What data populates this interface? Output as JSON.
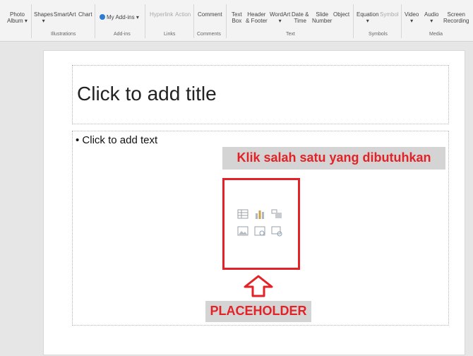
{
  "ribbon": {
    "items": [
      {
        "label": "Photo\nAlbum ▾"
      },
      {
        "label": "Shapes\n▾"
      },
      {
        "label": "SmartArt"
      },
      {
        "label": "Chart"
      },
      {
        "label": "My Add-ins"
      },
      {
        "label": "Hyperlink"
      },
      {
        "label": "Action"
      },
      {
        "label": "Comment"
      },
      {
        "label": "Text\nBox"
      },
      {
        "label": "Header\n& Footer"
      },
      {
        "label": "WordArt\n▾"
      },
      {
        "label": "Date &\nTime"
      },
      {
        "label": "Slide\nNumber"
      },
      {
        "label": "Object"
      },
      {
        "label": "Equation\n▾"
      },
      {
        "label": "Symbol"
      },
      {
        "label": "Video\n▾"
      },
      {
        "label": "Audio\n▾"
      },
      {
        "label": "Screen\nRecording"
      }
    ],
    "groups": [
      "Illustrations",
      "Add-ins",
      "Links",
      "Comments",
      "Text",
      "Symbols",
      "Media"
    ]
  },
  "slide": {
    "title_placeholder": "Click to add title",
    "body_placeholder": "• Click to add text"
  },
  "annotations": {
    "callout": "Klik salah satu yang dibutuhkan",
    "placeholder_label": "PLACEHOLDER"
  },
  "colors": {
    "annotation_red": "#e32227",
    "annotation_bg": "#d4d4d4"
  },
  "icons": [
    "table-icon",
    "chart-icon",
    "smartart-icon",
    "picture-icon",
    "online-picture-icon",
    "video-icon",
    "up-arrow-icon"
  ]
}
